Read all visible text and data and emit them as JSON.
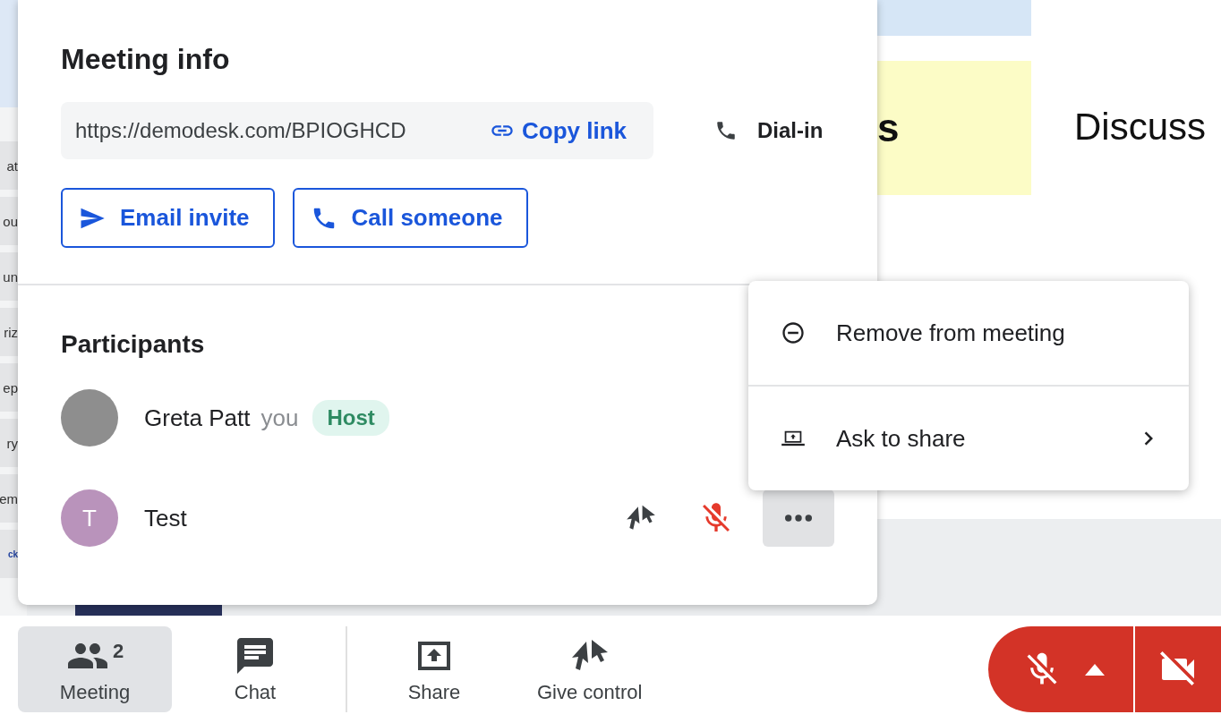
{
  "slide_strip": {
    "items": [
      "at",
      "ou",
      "un",
      "riz",
      "ep",
      "ry",
      "em",
      "ck"
    ]
  },
  "slide": {
    "heading_fragment": "s",
    "text": "Discuss"
  },
  "meeting_info": {
    "title": "Meeting info",
    "link": "https://demodesk.com/BPIOGHCD",
    "copy_link": "Copy link",
    "dial_in": "Dial-in",
    "buttons": [
      {
        "label": "Email invite"
      },
      {
        "label": "Call someone"
      }
    ]
  },
  "participants": {
    "title": "Participants",
    "items": [
      {
        "name": "Greta Patt",
        "you_label": "you",
        "role": "Host",
        "avatar": {
          "kind": "photo"
        },
        "show_controls": false
      },
      {
        "name": "Test",
        "avatar": {
          "kind": "initial",
          "initial": "T",
          "color": "#b993bb"
        },
        "show_controls": true,
        "muted": true,
        "menu_open": true
      }
    ]
  },
  "context_menu": {
    "items": [
      {
        "label": "Remove from meeting",
        "submenu": false
      },
      {
        "label": "Ask to share",
        "submenu": true
      }
    ]
  },
  "toolbar": {
    "items": [
      {
        "label": "Meeting",
        "badge": "2",
        "selected": true,
        "divider_before": false
      },
      {
        "label": "Chat",
        "selected": false,
        "divider_before": false
      },
      {
        "label": "Share",
        "selected": false,
        "divider_before": true
      },
      {
        "label": "Give control",
        "selected": false,
        "divider_before": false
      }
    ]
  },
  "media": {
    "mic_muted": true,
    "camera_off": true
  }
}
